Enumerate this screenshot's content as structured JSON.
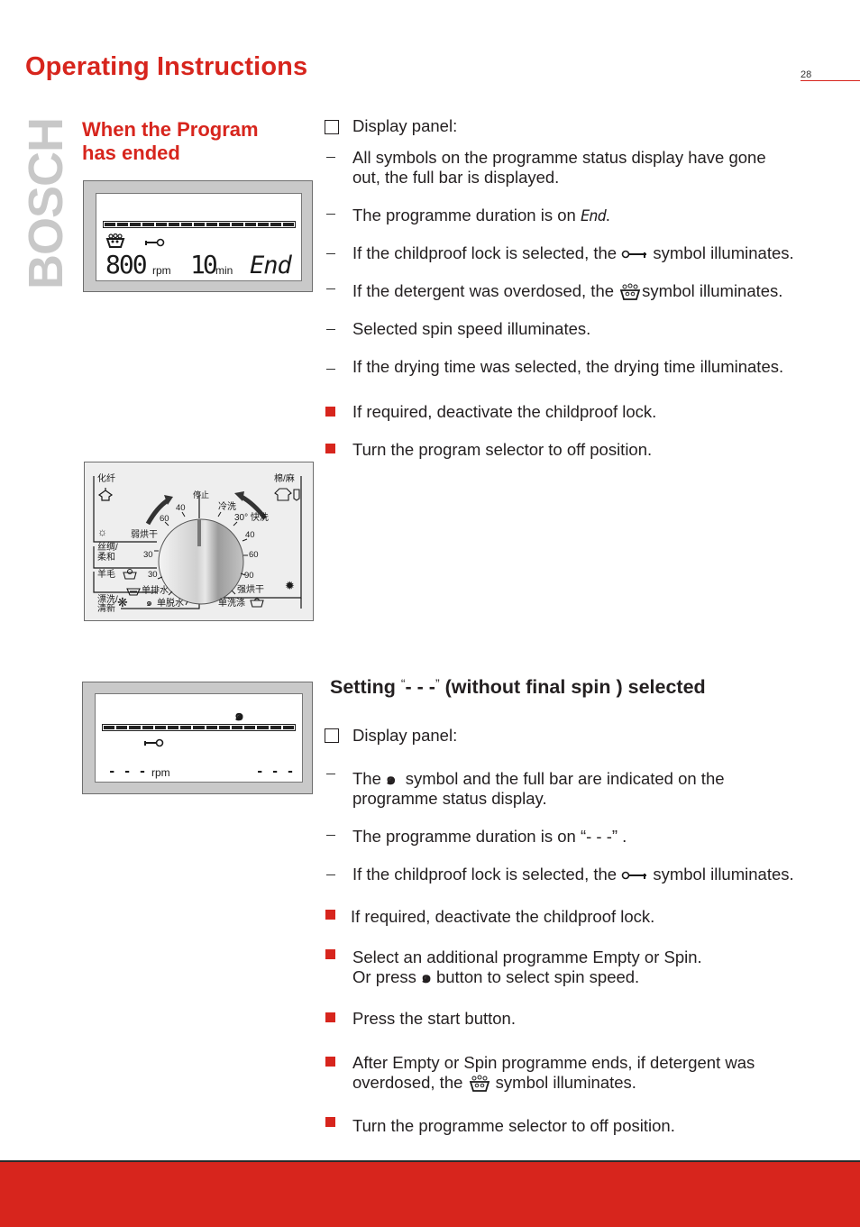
{
  "header": {
    "title": "Operating Instructions",
    "page_number": "28",
    "brand": "BOSCH"
  },
  "section1": {
    "heading_line1": "When the Program",
    "heading_line2": "has ended",
    "display_panel_label": "Display panel:",
    "lcd": {
      "spin_value": "800",
      "spin_unit": "rpm",
      "time_value": "10",
      "time_unit": "min",
      "status": "End"
    },
    "notes": [
      {
        "type": "dash",
        "line1": "All symbols on the programme status display have gone",
        "line2": "out, the full bar is displayed."
      },
      {
        "type": "dash",
        "before": "The programme duration is on ",
        "code": "End",
        "after": "."
      },
      {
        "type": "dash",
        "before": "If the childproof lock is selected, the ",
        "icon": "key-icon",
        "after": " symbol illuminates."
      },
      {
        "type": "dash",
        "before": "If the detergent was overdosed, the ",
        "icon": "detergent-overdose-icon",
        "after": "symbol illuminates."
      },
      {
        "type": "dash",
        "text": "Selected spin speed illuminates."
      },
      {
        "type": "dash",
        "text": "If the drying time was selected, the drying time illuminates."
      }
    ],
    "steps": [
      "If required, deactivate the childproof lock.",
      "Turn the program selector to off position."
    ]
  },
  "dial": {
    "top_center": "停止",
    "top_left_group": "化纤",
    "top_right_group": "棉/麻",
    "left_labels": [
      "弱烘干",
      "丝绸/",
      "柔和",
      "羊毛"
    ],
    "right_labels": [
      "冷洗",
      "30° 快洗",
      "强烘干"
    ],
    "bottom_labels": [
      "单排水",
      "单脱水",
      "单洗涤",
      "漂洗/",
      "清新"
    ],
    "left_temps": [
      "40",
      "60",
      "30",
      "30"
    ],
    "right_temps": [
      "40",
      "60",
      "90"
    ]
  },
  "section2": {
    "heading_prefix": "Setting ",
    "heading_quote_open": "“",
    "heading_code": "- - -",
    "heading_quote_close": "”",
    "heading_suffix": " (without final spin ) selected",
    "display_panel_label": "Display panel:",
    "lcd": {
      "spin_value": "- - -",
      "spin_unit": "rpm",
      "time_value": "- - -"
    },
    "notes": [
      {
        "type": "dash",
        "before": "The ",
        "icon": "spin-icon",
        "after": "  symbol and the full bar are indicated on the",
        "line2": "programme status display."
      },
      {
        "type": "dash",
        "text": "The programme duration is on “- - -” ."
      },
      {
        "type": "dash",
        "before": "If the childproof lock is selected, the ",
        "icon": "key-icon",
        "after": " symbol illuminates."
      }
    ],
    "steps": [
      {
        "text": "If required, deactivate the childproof lock."
      },
      {
        "line1": "Select an additional programme Empty or Spin.",
        "line2_before": "Or press ",
        "line2_icon": "spin-icon",
        "line2_after": " button to select spin speed."
      },
      {
        "text": "Press the start button."
      },
      {
        "line1": "After Empty or Spin programme ends, if detergent was",
        "line2_before": "overdosed, the ",
        "line2_icon": "detergent-overdose-icon",
        "line2_after": " symbol illuminates."
      },
      {
        "text": "Turn the programme selector to off position."
      }
    ]
  },
  "colors": {
    "brand_red": "#d7251d",
    "text": "#231f20",
    "watermark_gray": "#c8c8c8"
  }
}
